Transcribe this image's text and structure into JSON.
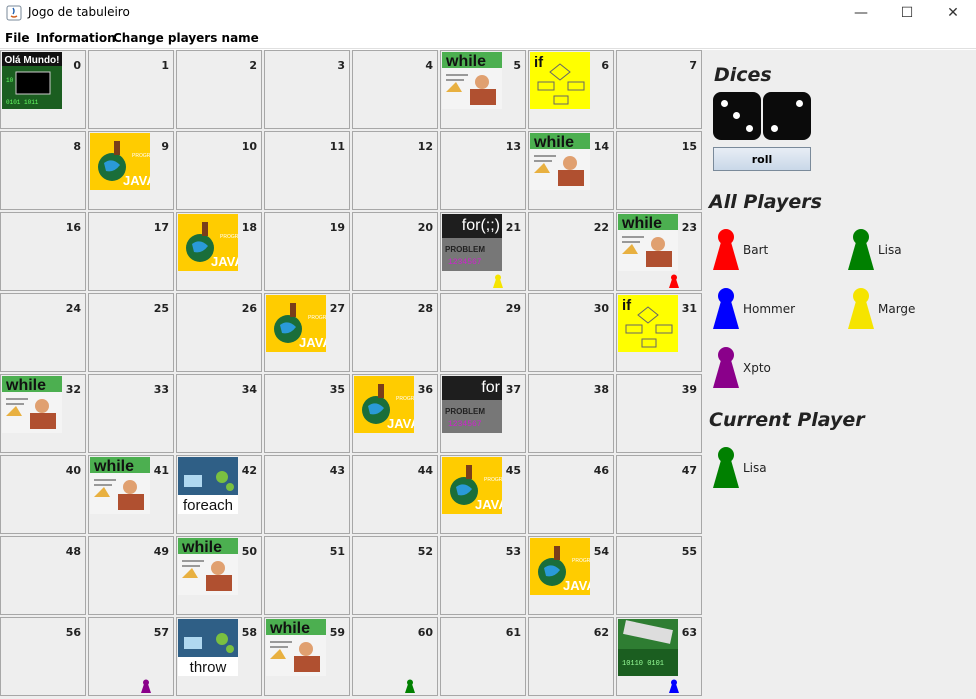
{
  "window": {
    "title": "Jogo de tabuleiro",
    "controls": {
      "minimize": "—",
      "maximize": "☐",
      "close": "✕"
    }
  },
  "menu": [
    "File",
    "Information",
    "Change players name"
  ],
  "board": {
    "rows": [
      [
        0,
        1,
        2,
        3,
        4,
        5,
        6,
        7
      ],
      [
        8,
        9,
        10,
        11,
        12,
        13,
        14,
        15
      ],
      [
        16,
        17,
        18,
        19,
        20,
        21,
        22,
        23
      ],
      [
        24,
        25,
        26,
        27,
        28,
        29,
        30,
        31
      ],
      [
        32,
        33,
        34,
        35,
        36,
        37,
        38,
        39
      ],
      [
        40,
        41,
        42,
        43,
        44,
        45,
        46,
        47
      ],
      [
        48,
        49,
        50,
        51,
        52,
        53,
        54,
        55
      ],
      [
        56,
        57,
        58,
        59,
        60,
        61,
        62,
        63
      ]
    ],
    "tiles": {
      "0": {
        "type": "hello",
        "caption": "Olá Mundo!"
      },
      "5": {
        "type": "while",
        "caption": "while"
      },
      "6": {
        "type": "if",
        "caption": "if"
      },
      "9": {
        "type": "java",
        "caption": "JAVA"
      },
      "14": {
        "type": "while",
        "caption": "while"
      },
      "18": {
        "type": "java",
        "caption": "JAVA"
      },
      "21": {
        "type": "for",
        "caption": "for(;;)"
      },
      "23": {
        "type": "while",
        "caption": "while"
      },
      "27": {
        "type": "java",
        "caption": "JAVA"
      },
      "31": {
        "type": "if",
        "caption": "if"
      },
      "32": {
        "type": "while",
        "caption": "while"
      },
      "36": {
        "type": "java",
        "caption": "JAVA"
      },
      "37": {
        "type": "for",
        "caption": "for"
      },
      "41": {
        "type": "while",
        "caption": "while"
      },
      "42": {
        "type": "tech",
        "caption": "foreach"
      },
      "45": {
        "type": "java",
        "caption": "JAVA"
      },
      "50": {
        "type": "while",
        "caption": "while"
      },
      "54": {
        "type": "java",
        "caption": "JAVA"
      },
      "58": {
        "type": "tech",
        "caption": "throw"
      },
      "59": {
        "type": "while",
        "caption": "while"
      },
      "63": {
        "type": "binary",
        "caption": ""
      }
    },
    "pawns_on_board": [
      {
        "cell": 21,
        "color": "#f5e400"
      },
      {
        "cell": 23,
        "color": "#ff0000"
      },
      {
        "cell": 57,
        "color": "#8a008a"
      },
      {
        "cell": 60,
        "color": "#008000"
      },
      {
        "cell": 63,
        "color": "#0000ff"
      }
    ]
  },
  "sidebar": {
    "dices_heading": "Dices",
    "dice_values": [
      3,
      2
    ],
    "roll_label": "roll",
    "all_players_heading": "All Players",
    "players": [
      {
        "name": "Bart",
        "color": "#ff0000"
      },
      {
        "name": "Lisa",
        "color": "#008000"
      },
      {
        "name": "Hommer",
        "color": "#0000ff"
      },
      {
        "name": "Marge",
        "color": "#f5e400"
      },
      {
        "name": "Xpto",
        "color": "#8a008a"
      }
    ],
    "current_player_heading": "Current Player",
    "current_player": {
      "name": "Lisa",
      "color": "#008000"
    }
  }
}
